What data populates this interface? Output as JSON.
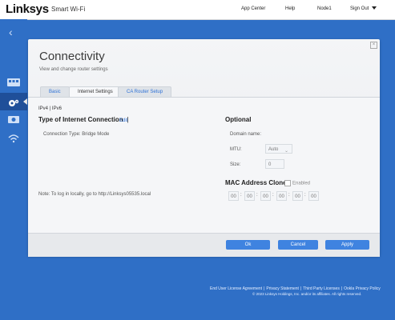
{
  "header": {
    "brand": "Linksys",
    "product": "Smart Wi-Fi",
    "nav": {
      "app_center": "App Center",
      "help": "Help",
      "node": "Node1",
      "sign_out": "Sign Out"
    }
  },
  "page": {
    "title": "Connectivity",
    "subtitle": "View and change router settings",
    "tabs": [
      "Basic",
      "Internet Settings",
      "CA Router Setup"
    ],
    "ip_mode": "IPv4 | IPv6",
    "left": {
      "heading": "Type of Internet Connection",
      "edit": "Edit",
      "connection_type": "Connection Type: Bridge Mode",
      "note": "Note: To log in locally, go to http://Linksys05535.local"
    },
    "right": {
      "heading": "Optional",
      "domain_label": "Domain name:",
      "mtu_label": "MTU:",
      "mtu_value": "Auto",
      "size_label": "Size:",
      "size_value": "0",
      "mac_heading": "MAC Address Clone",
      "mac_enabled": "Enabled",
      "mac_octets": [
        "00",
        "00",
        "00",
        "00",
        "00",
        "00"
      ]
    },
    "buttons": {
      "ok": "Ok",
      "cancel": "Cancel",
      "apply": "Apply"
    }
  },
  "footer": {
    "links": [
      "End User License Agreement",
      "Privacy Statement",
      "Third Party Licenses",
      "Ookla Privacy Policy"
    ],
    "copyright": "© 2023 Linksys Holdings, Inc. and/or its affiliates. All rights reserved."
  },
  "colors": {
    "background": "#2f6fc6",
    "accent": "#3f83e0",
    "link": "#2f72d6"
  }
}
